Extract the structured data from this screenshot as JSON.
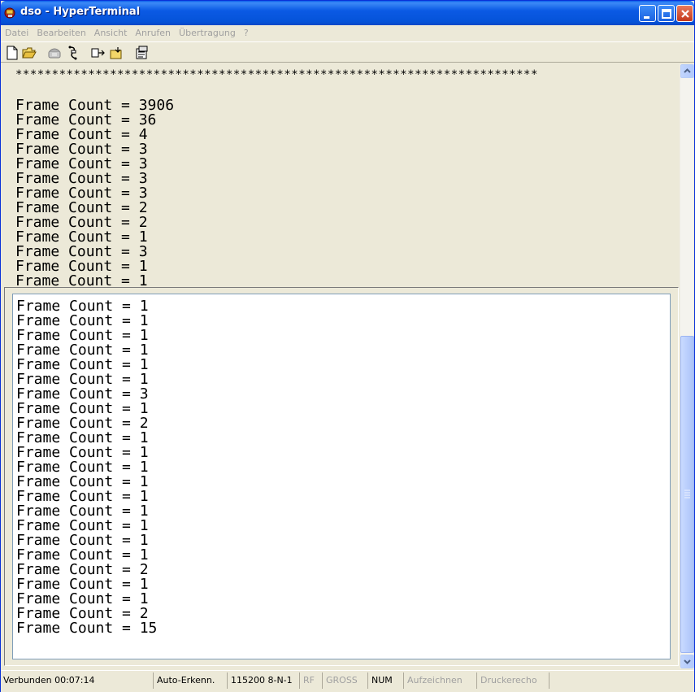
{
  "window": {
    "title": "dso - HyperTerminal"
  },
  "menu": {
    "items": [
      "Datei",
      "Bearbeiten",
      "Ansicht",
      "Anrufen",
      "Übertragung",
      "?"
    ]
  },
  "toolbar": {
    "icons": [
      "new-document-icon",
      "open-folder-icon",
      "connect-phone-icon",
      "disconnect-icon",
      "send-file-icon",
      "receive-file-icon",
      "properties-icon"
    ]
  },
  "terminal": {
    "separator": "************************************************************************",
    "upper_lines": [
      "Frame Count = 3906",
      "Frame Count = 36",
      "Frame Count = 4",
      "Frame Count = 3",
      "Frame Count = 3",
      "Frame Count = 3",
      "Frame Count = 3",
      "Frame Count = 2",
      "Frame Count = 2",
      "Frame Count = 1",
      "Frame Count = 3",
      "Frame Count = 1",
      "Frame Count = 1"
    ],
    "lower_lines": [
      "Frame Count = 1",
      "Frame Count = 1",
      "Frame Count = 1",
      "Frame Count = 1",
      "Frame Count = 1",
      "Frame Count = 1",
      "Frame Count = 3",
      "Frame Count = 1",
      "Frame Count = 2",
      "Frame Count = 1",
      "Frame Count = 1",
      "Frame Count = 1",
      "Frame Count = 1",
      "Frame Count = 1",
      "Frame Count = 1",
      "Frame Count = 1",
      "Frame Count = 1",
      "Frame Count = 1",
      "Frame Count = 2",
      "Frame Count = 1",
      "Frame Count = 1",
      "Frame Count = 2",
      "Frame Count = 15"
    ]
  },
  "status": {
    "connected": "Verbunden 00:07:14",
    "detect": "Auto-Erkenn.",
    "port": "115200 8-N-1",
    "rf": "RF",
    "caps": "GROSS",
    "num": "NUM",
    "capture": "Aufzeichnen",
    "print_echo": "Druckerecho"
  }
}
